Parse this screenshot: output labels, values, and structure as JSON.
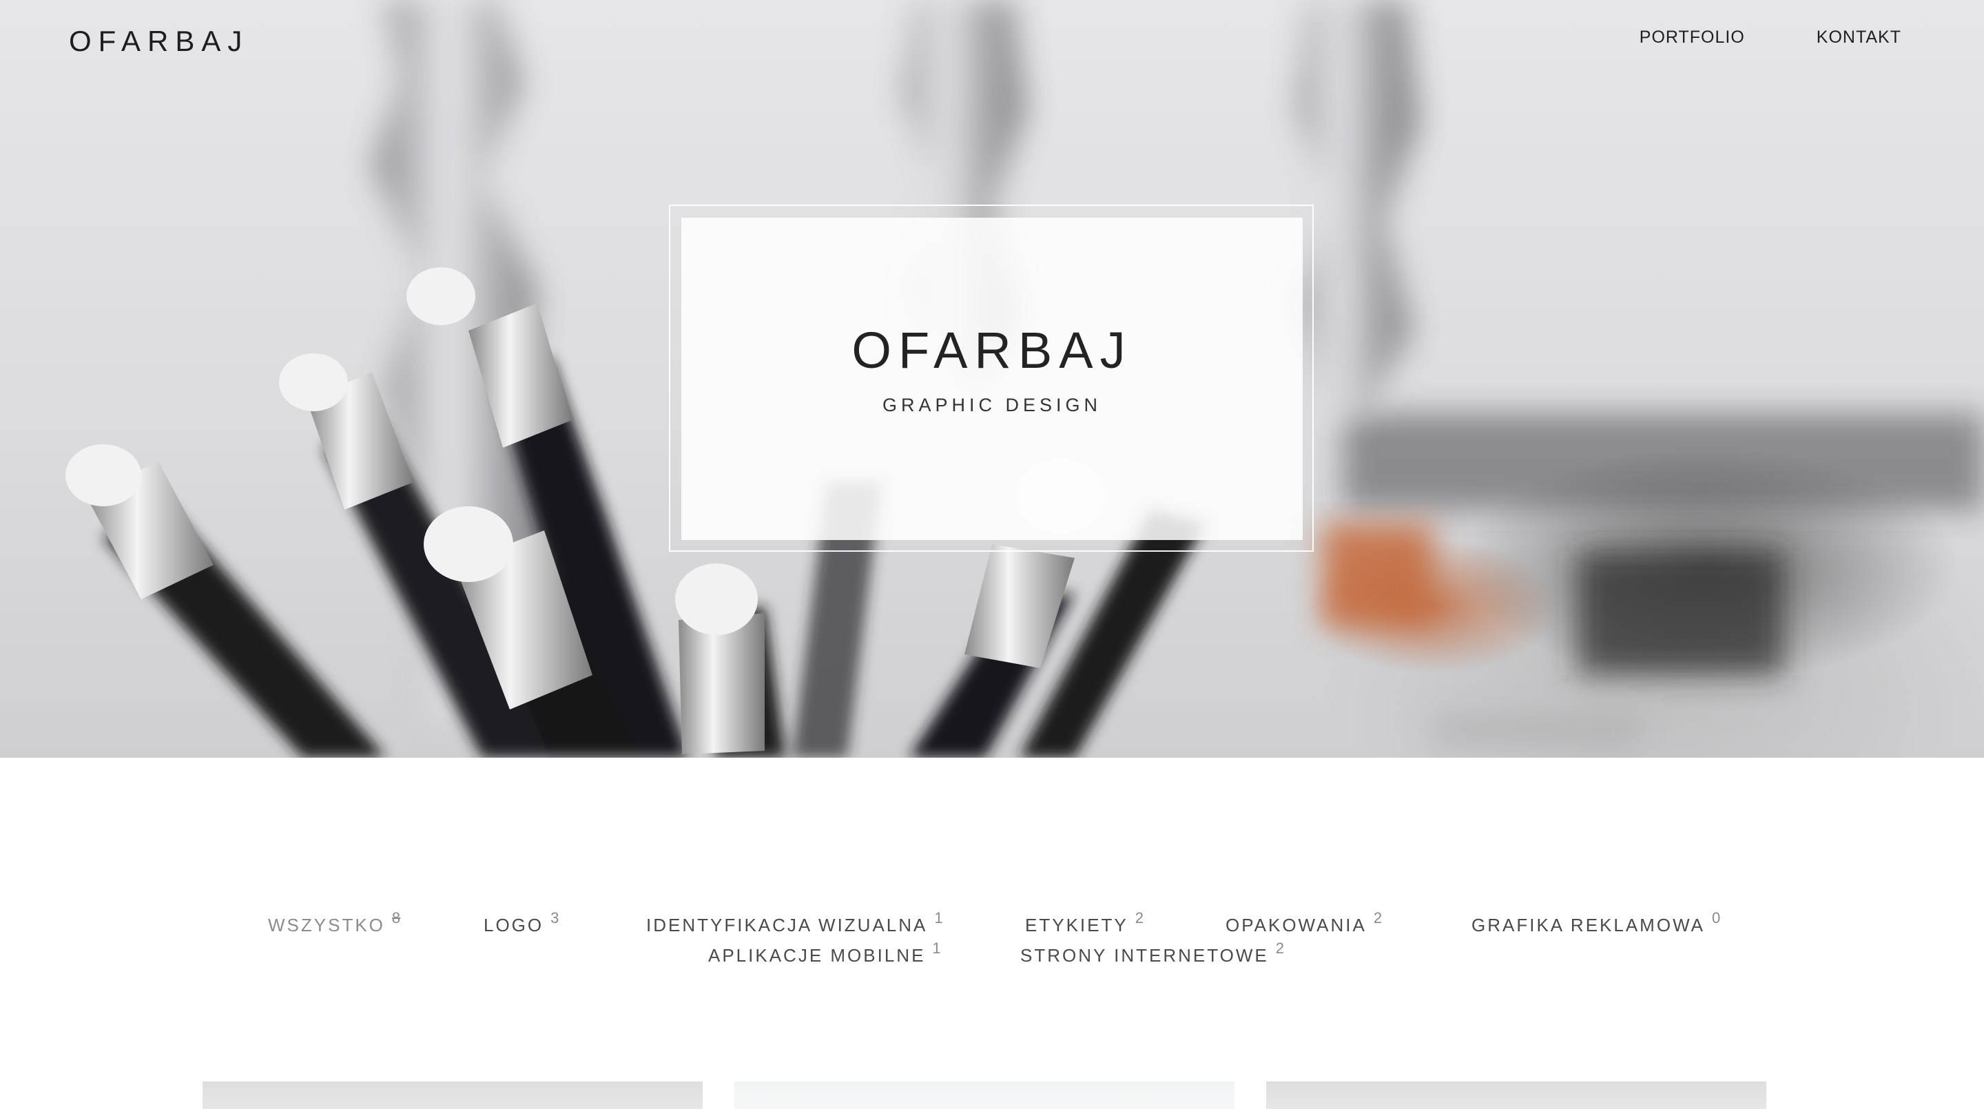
{
  "header": {
    "logo": "OFARBAJ",
    "nav": [
      {
        "label": "PORTFOLIO"
      },
      {
        "label": "KONTAKT"
      }
    ]
  },
  "hero": {
    "title": "OFARBAJ",
    "subtitle": "GRAPHIC DESIGN"
  },
  "filters": [
    {
      "label": "WSZYSTKO",
      "count": "8"
    },
    {
      "label": "LOGO",
      "count": "3"
    },
    {
      "label": "IDENTYFIKACJA WIZUALNA",
      "count": "1"
    },
    {
      "label": "ETYKIETY",
      "count": "2"
    },
    {
      "label": "OPAKOWANIA",
      "count": "2"
    },
    {
      "label": "GRAFIKA REKLAMOWA",
      "count": "0"
    },
    {
      "label": "APLIKACJE MOBILNE",
      "count": "1"
    },
    {
      "label": "STRONY INTERNETOWE",
      "count": "2"
    }
  ],
  "active_filter": "WSZYSTKO",
  "colors": {
    "text_dark": "#1e1e1e",
    "filter_text": "#4a4a4a",
    "filter_active": "#8c8c8c",
    "accent_orange": "#c4683a"
  }
}
